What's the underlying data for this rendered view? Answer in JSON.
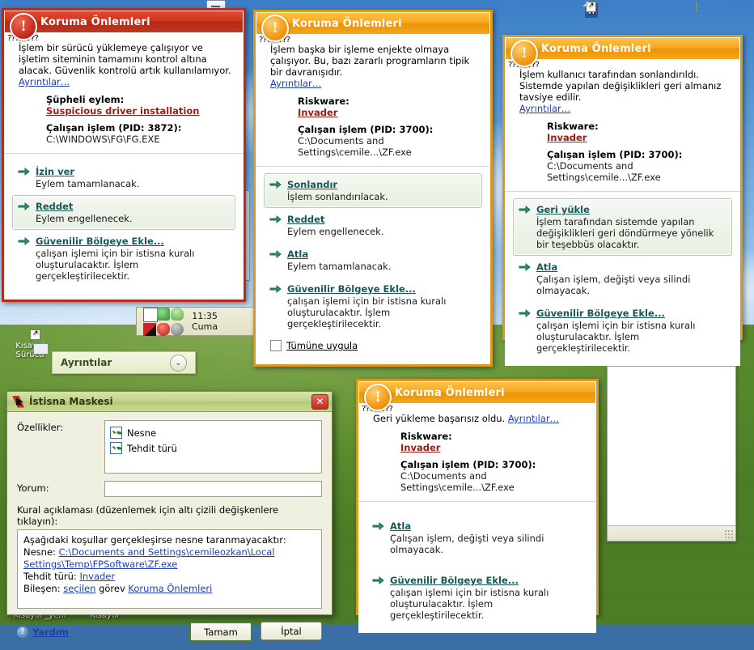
{
  "desktop": {
    "icons": [
      {
        "name": "kisayol-surucu",
        "label": "Kısayol\nSürücü"
      },
      {
        "name": "kisayol-yeni",
        "label": "Kısayol _yeni"
      },
      {
        "name": "kisayol",
        "label": "Kısayol"
      },
      {
        "name": "word-doc",
        "label": ""
      },
      {
        "name": "notepad-doc",
        "label": ""
      }
    ]
  },
  "tray": {
    "time": "11:35",
    "day": "Cuma"
  },
  "details_panel": {
    "label": "Ayrıntılar",
    "chevron": "⌄"
  },
  "common": {
    "qmarks": "????????",
    "details_link": "Ayrıntılar…",
    "riskware_label": "Riskware:",
    "riskware_value": "Invader",
    "process_pid_3700": "Çalışan işlem (PID: 3700):",
    "process_path_zf": "C:\\Documents and Settings\\cemile...\\ZF.exe",
    "arrow": "➜"
  },
  "alert1": {
    "title": "Koruma Önlemleri",
    "accent": "#b52b20",
    "lead": "İşlem bir sürücü yüklemeye çalışıyor ve işletim siteminin tamamını kontrol altına alacak. Güvenlik kontrolü artık kullanılamıyor.",
    "details_link": "Ayrıntılar…",
    "fields": [
      {
        "key": "Şüpheli eylem:",
        "value": "Suspicious driver installation",
        "style": "red"
      },
      {
        "key": "Çalışan işlem (PID: 3872):",
        "value": "C:\\WINDOWS\\FG\\FG.EXE",
        "style": "plain"
      }
    ],
    "actions": [
      {
        "title": "İzin ver",
        "desc": "Eylem tamamlanacak.",
        "selected": false
      },
      {
        "title": "Reddet",
        "desc": "Eylem engellenecek.",
        "selected": true
      },
      {
        "title": "Güvenilir Bölgeye Ekle...",
        "desc": "çalışan işlemi için bir istisna kuralı oluşturulacaktır. İşlem gerçekleştirilecektir.",
        "selected": false
      }
    ]
  },
  "alert2": {
    "title": "Koruma Önlemleri",
    "accent": "#d99820",
    "lead": "İşlem başka bir işleme enjekte olmaya çalışıyor. Bu, bazı zararlı programların tipik bir davranışıdır.",
    "details_link": "Ayrıntılar…",
    "fields": [
      {
        "key": "Riskware:",
        "value": "Invader",
        "style": "red"
      },
      {
        "key": "Çalışan işlem (PID: 3700):",
        "value": "C:\\Documents and Settings\\cemile...\\ZF.exe",
        "style": "plain"
      }
    ],
    "actions": [
      {
        "title": "Sonlandır",
        "desc": "İşlem sonlandırılacak.",
        "selected": true
      },
      {
        "title": "Reddet",
        "desc": "Eylem engellenecek.",
        "selected": false
      },
      {
        "title": "Atla",
        "desc": "Eylem tamamlanacak.",
        "selected": false
      },
      {
        "title": "Güvenilir Bölgeye Ekle...",
        "desc": "çalışan işlemi için bir istisna kuralı oluşturulacaktır. İşlem gerçekleştirilecektir.",
        "selected": false
      }
    ],
    "checkbox_label": "Tümüne uygula",
    "checkbox_checked": false
  },
  "alert3": {
    "title": "Koruma Önlemleri",
    "accent": "#d99820",
    "lead": "İşlem kullanıcı tarafından sonlandırıldı. Sistemde yapılan değişiklikleri geri almanız tavsiye edilir.",
    "details_link": "Ayrıntılar…",
    "fields": [
      {
        "key": "Riskware:",
        "value": "Invader",
        "style": "red"
      },
      {
        "key": "Çalışan işlem (PID: 3700):",
        "value": "C:\\Documents and Settings\\cemile...\\ZF.exe",
        "style": "plain"
      }
    ],
    "actions": [
      {
        "title": "Geri yükle",
        "desc": "İşlem tarafından sistemde yapılan değişiklikleri geri döndürmeye yönelik bir teşebbüs olacaktır.",
        "selected": true
      },
      {
        "title": "Atla",
        "desc": "Çalışan işlem, değişti veya silindi olmayacak.",
        "selected": false
      },
      {
        "title": "Güvenilir Bölgeye Ekle...",
        "desc": "çalışan işlemi için bir istisna kuralı oluşturulacaktır. İşlem gerçekleştirilecektir.",
        "selected": false
      }
    ]
  },
  "alert4": {
    "title": "Koruma Önlemleri",
    "accent": "#d99820",
    "lead": "Geri yükleme başarısız oldu.",
    "details_link": "Ayrıntılar…",
    "fields": [
      {
        "key": "Riskware:",
        "value": "Invader",
        "style": "red"
      },
      {
        "key": "Çalışan işlem (PID: 3700):",
        "value": "C:\\Documents and Settings\\cemile...\\ZF.exe",
        "style": "plain"
      }
    ],
    "actions": [
      {
        "title": "Atla",
        "desc": "Çalışan işlem, değişti veya silindi olmayacak.",
        "selected": false
      },
      {
        "title": "Güvenilir Bölgeye Ekle...",
        "desc": "çalışan işlemi için bir istisna kuralı oluşturulacaktır. İşlem gerçekleştirilecektir.",
        "selected": false
      }
    ]
  },
  "mask_dialog": {
    "title": "İstisna Maskesi",
    "close": "✕",
    "properties_label": "Özellikler:",
    "properties": [
      {
        "label": "Nesne",
        "checked": true
      },
      {
        "label": "Tehdit türü",
        "checked": true
      }
    ],
    "comment_label": "Yorum:",
    "comment_value": "",
    "rule_caption": "Kural açıklaması (düzenlemek için altı çizili değişkenlere tıklayın):",
    "rule_intro": "Aşağıdaki koşullar gerçekleşirse nesne taranmayacaktır:",
    "rule_object_label": "Nesne:",
    "rule_object_value": "C:\\Documents and Settings\\cemileozkan\\Local Settings\\Temp\\FPSoftware\\ZF.exe",
    "rule_threat_label": "Tehdit türü:",
    "rule_threat_value": "Invader",
    "rule_component_label": "Bileşen:",
    "rule_component_value": "seçilen",
    "rule_component_mid": "görev",
    "rule_component_task": "Koruma Önlemleri",
    "help": "Yardım",
    "ok": "Tamam",
    "cancel": "İptal"
  }
}
